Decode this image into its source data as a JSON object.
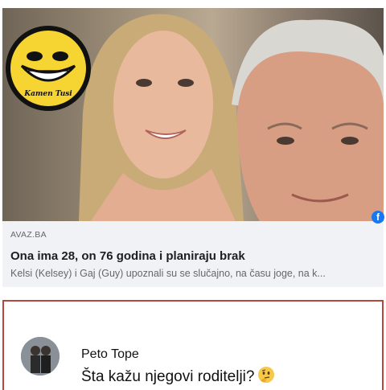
{
  "link_preview": {
    "source": "AVAZ.BA",
    "headline": "Ona ima 28, on 76 godina i planiraju brak",
    "excerpt": "Kelsi (Kelsey) i Gaj (Guy) upoznali su se slučajno, na času joge, na k...",
    "photo_icon": "photo-of-couple",
    "watermark_logo_text": "Kamen Tusi",
    "corner_badge": "f"
  },
  "comment": {
    "author": "Peto Tope",
    "text": "Šta kažu njegovi roditelji?",
    "emoji": "thinking-face"
  },
  "colors": {
    "highlight_border": "#b5473f",
    "logo_yellow": "#f6d533",
    "link_title": "#1c1e21",
    "meta_gray": "#65676b"
  }
}
